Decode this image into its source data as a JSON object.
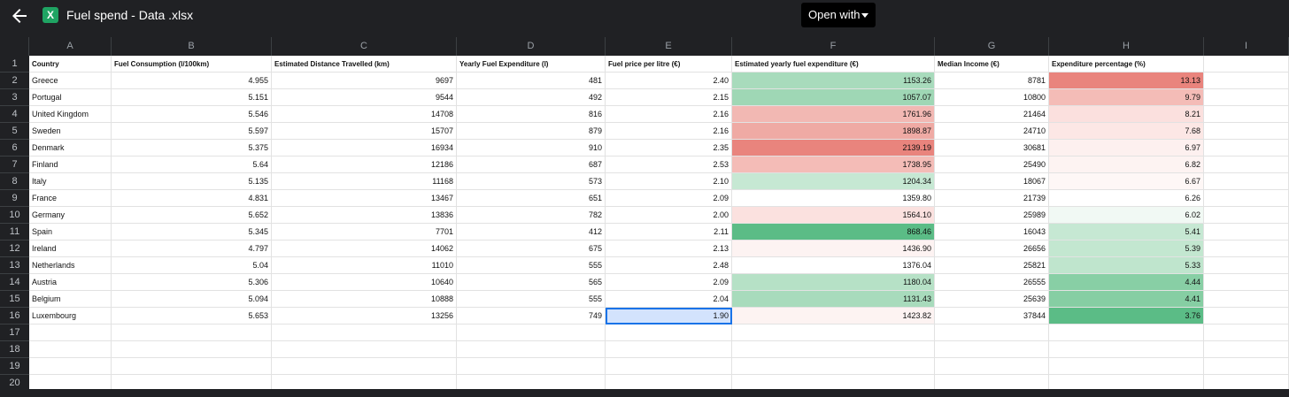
{
  "topbar": {
    "title": "Fuel spend - Data .xlsx",
    "open_with_label": "Open with",
    "back_icon": "arrow-left-icon",
    "file_icon_letter": "X",
    "file_icon_color": "#1fa463"
  },
  "columns": [
    "A",
    "B",
    "C",
    "D",
    "E",
    "F",
    "G",
    "H",
    "I"
  ],
  "row_numbers": [
    "1",
    "2",
    "3",
    "4",
    "5",
    "6",
    "7",
    "8",
    "9",
    "10",
    "11",
    "12",
    "13",
    "14",
    "15",
    "16",
    "17",
    "18",
    "19",
    "20"
  ],
  "headers": [
    "Country",
    "Fuel Consumption (l/100km)",
    "Estimated Distance Travelled (km)",
    "Yearly Fuel Expenditure (l)",
    "Fuel price per litre (€)",
    "Estimated yearly fuel expenditure (€)",
    "Median Income (€)",
    "Expenditure percentage (%)"
  ],
  "rows": [
    [
      "Greece",
      "4.955",
      "9697",
      "481",
      "2.40",
      "1153.26",
      "8781",
      "13.13"
    ],
    [
      "Portugal",
      "5.151",
      "9544",
      "492",
      "2.15",
      "1057.07",
      "10800",
      "9.79"
    ],
    [
      "United Kingdom",
      "5.546",
      "14708",
      "816",
      "2.16",
      "1761.96",
      "21464",
      "8.21"
    ],
    [
      "Sweden",
      "5.597",
      "15707",
      "879",
      "2.16",
      "1898.87",
      "24710",
      "7.68"
    ],
    [
      "Denmark",
      "5.375",
      "16934",
      "910",
      "2.35",
      "2139.19",
      "30681",
      "6.97"
    ],
    [
      "Finland",
      "5.64",
      "12186",
      "687",
      "2.53",
      "1738.95",
      "25490",
      "6.82"
    ],
    [
      "Italy",
      "5.135",
      "11168",
      "573",
      "2.10",
      "1204.34",
      "18067",
      "6.67"
    ],
    [
      "France",
      "4.831",
      "13467",
      "651",
      "2.09",
      "1359.80",
      "21739",
      "6.26"
    ],
    [
      "Germany",
      "5.652",
      "13836",
      "782",
      "2.00",
      "1564.10",
      "25989",
      "6.02"
    ],
    [
      "Spain",
      "5.345",
      "7701",
      "412",
      "2.11",
      "868.46",
      "16043",
      "5.41"
    ],
    [
      "Ireland",
      "4.797",
      "14062",
      "675",
      "2.13",
      "1436.90",
      "26656",
      "5.39"
    ],
    [
      "Netherlands",
      "5.04",
      "11010",
      "555",
      "2.48",
      "1376.04",
      "25821",
      "5.33"
    ],
    [
      "Austria",
      "5.306",
      "10640",
      "565",
      "2.09",
      "1180.04",
      "26555",
      "4.44"
    ],
    [
      "Belgium",
      "5.094",
      "10888",
      "555",
      "2.04",
      "1131.43",
      "25639",
      "4.41"
    ],
    [
      "Luxembourg",
      "5.653",
      "13256",
      "749",
      "1.90",
      "1423.82",
      "37844",
      "3.76"
    ]
  ],
  "colors_F": [
    "#a8dbbc",
    "#9fd7b5",
    "#f2b8b3",
    "#efaaa4",
    "#e9847d",
    "#f4bcb7",
    "#c6e8d3",
    "#ffffff",
    "#fbe1df",
    "#5bbc86",
    "#fdf3f2",
    "#ffffff",
    "#b6e1c6",
    "#a8dbbc",
    "#fdf3f2"
  ],
  "colors_H": [
    "#e9847d",
    "#f4bcb7",
    "#fbe0de",
    "#fce7e5",
    "#fdf0ef",
    "#fdf3f2",
    "#fef7f6",
    "#ffffff",
    "#f1f9f4",
    "#c6e8d3",
    "#c3e7d0",
    "#bfe5cd",
    "#88cfa5",
    "#86cea3",
    "#5bbc86"
  ],
  "selected_cell": "E16"
}
